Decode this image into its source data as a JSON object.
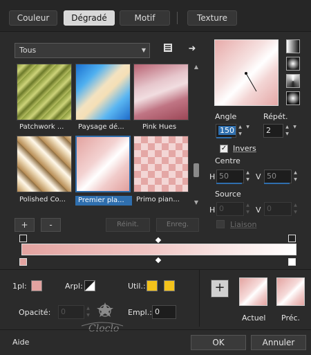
{
  "tabs": [
    {
      "label": "Couleur"
    },
    {
      "label": "Dégradé"
    },
    {
      "label": "Motif"
    },
    {
      "label": "Texture"
    }
  ],
  "category": {
    "selected": "Tous"
  },
  "gallery": {
    "items": [
      {
        "label": "Patchwork ..."
      },
      {
        "label": "Paysage dé..."
      },
      {
        "label": "Pink Hues"
      },
      {
        "label": "Polished Co..."
      },
      {
        "label": "Premier pla..."
      },
      {
        "label": "Primo pian..."
      }
    ],
    "add_label": "+",
    "remove_label": "-",
    "reset_label": "Réinit.",
    "save_label": "Enreg."
  },
  "settings": {
    "angle_label": "Angle",
    "angle_value": "150",
    "repeat_label": "Répét.",
    "repeat_value": "2",
    "invert_label": "Invers",
    "center_label": "Centre",
    "center_h_label": "H",
    "center_h_value": "50",
    "center_v_label": "V",
    "center_v_value": "50",
    "source_label": "Source",
    "source_h_label": "H",
    "source_h_value": "0",
    "source_v_label": "V",
    "source_v_value": "0",
    "link_label": "Liaison"
  },
  "stops": {
    "first_label": "1pl:",
    "arpl_label": "Arpl:",
    "util_label": "Util.:",
    "opacity_label": "Opacité:",
    "opacity_value": "0",
    "empl_label": "Empl.:",
    "empl_value": "0",
    "current_label": "Actuel",
    "previous_label": "Préc.",
    "add_label": "+"
  },
  "footer": {
    "help_label": "Aide",
    "ok_label": "OK",
    "cancel_label": "Annuler",
    "watermark_label": "Cloclo"
  },
  "colors": {
    "accent": "#2f6fae",
    "gradient_start": "#e3a3a0",
    "gradient_end": "#ffffff",
    "util_color": "#f3c21b"
  }
}
